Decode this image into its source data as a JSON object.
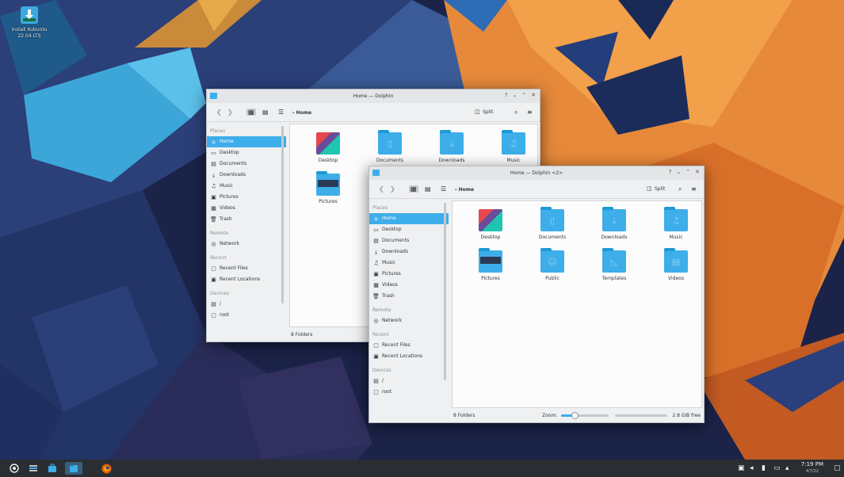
{
  "desktop": {
    "icons": [
      {
        "label_line1": "Install Kubuntu",
        "label_line2": "22.04 LTS"
      }
    ]
  },
  "window_back": {
    "title": "Home — Dolphin",
    "title_buttons": [
      "?",
      "⌄",
      "⌃",
      "✕"
    ],
    "breadcrumb": "Home",
    "split_label": "Split",
    "places_label": "Places",
    "places": [
      "Home",
      "Desktop",
      "Documents",
      "Downloads",
      "Music",
      "Pictures",
      "Videos",
      "Trash"
    ],
    "remote_label": "Remote",
    "remote": [
      "Network"
    ],
    "recent_label": "Recent",
    "recent": [
      "Recent Files",
      "Recent Locations"
    ],
    "devices_label": "Devices",
    "devices": [
      "/",
      "root"
    ],
    "folders": [
      "Desktop",
      "Documents",
      "Downloads",
      "Music",
      "Pictures"
    ],
    "status": "8 Folders"
  },
  "window_front": {
    "title": "Home — Dolphin <2>",
    "title_buttons": [
      "?",
      "⌄",
      "⌃",
      "✕"
    ],
    "breadcrumb": "Home",
    "split_label": "Split",
    "places_label": "Places",
    "places": [
      "Home",
      "Desktop",
      "Documents",
      "Downloads",
      "Music",
      "Pictures",
      "Videos",
      "Trash"
    ],
    "remote_label": "Remote",
    "remote": [
      "Network"
    ],
    "recent_label": "Recent",
    "recent": [
      "Recent Files",
      "Recent Locations"
    ],
    "devices_label": "Devices",
    "devices": [
      "/",
      "root"
    ],
    "folders": [
      "Desktop",
      "Documents",
      "Downloads",
      "Music",
      "Pictures",
      "Public",
      "Templates",
      "Videos"
    ],
    "status": "8 Folders",
    "zoom_label": "Zoom:",
    "free_space": "2.8 GiB free"
  },
  "taskbar": {
    "clock_time": "7:19 PM",
    "clock_date": "4/7/22"
  },
  "colors": {
    "accent": "#3daee9",
    "taskbar": "#2a2e32"
  }
}
